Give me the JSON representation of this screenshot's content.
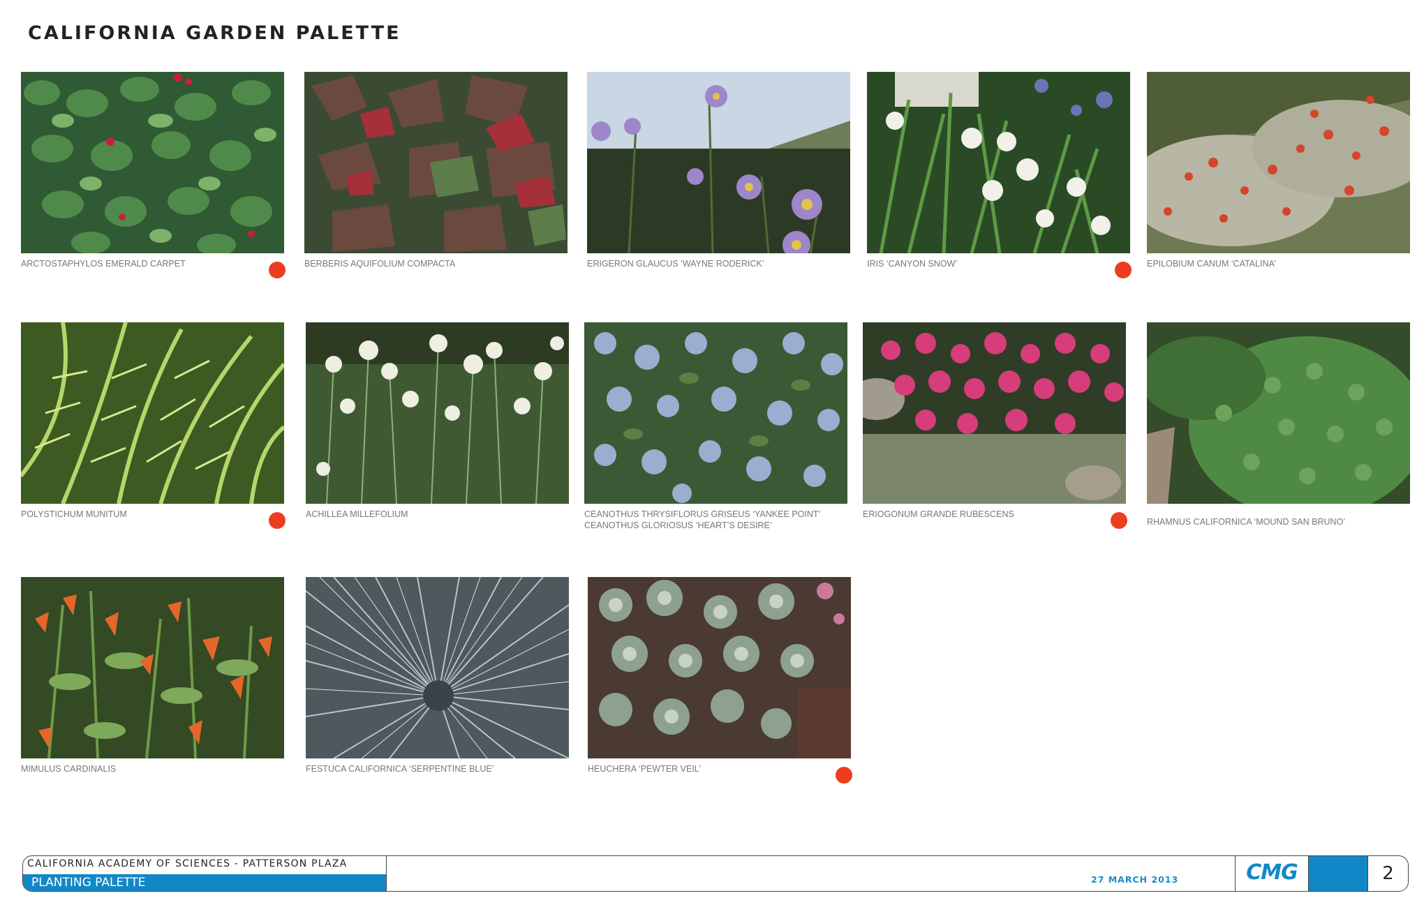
{
  "page": {
    "title": "CALIFORNIA GARDEN PALETTE",
    "marker_color": "#ec3d1f"
  },
  "plants": [
    {
      "caption": [
        "ARCTOSTAPHYLOS EMERALD CARPET"
      ],
      "marked": true
    },
    {
      "caption": [
        "BERBERIS AQUIFOLIUM COMPACTA"
      ],
      "marked": false
    },
    {
      "caption": [
        "ERIGERON GLAUCUS ‘WAYNE RODERICK’"
      ],
      "marked": false
    },
    {
      "caption": [
        "IRIS ‘CANYON SNOW’"
      ],
      "marked": true
    },
    {
      "caption": [
        "EPILOBIUM CANUM ‘CATALINA’"
      ],
      "marked": false
    },
    {
      "caption": [
        "POLYSTICHUM MUNITUM"
      ],
      "marked": true
    },
    {
      "caption": [
        "ACHILLEA MILLEFOLIUM"
      ],
      "marked": false
    },
    {
      "caption": [
        "CEANOTHUS THRYSIFLORUS GRISEUS ‘YANKEE POINT’",
        "CEANOTHUS GLORIOSUS ‘HEART’S DESIRE’"
      ],
      "marked": false
    },
    {
      "caption": [
        "ERIOGONUM GRANDE RUBESCENS"
      ],
      "marked": true
    },
    {
      "caption": [
        "RHAMNUS CALIFORNICA ‘MOUND SAN BRUNO’"
      ],
      "marked": false
    },
    {
      "caption": [
        "MIMULUS CARDINALIS"
      ],
      "marked": false
    },
    {
      "caption": [
        "FESTUCA CALIFORNICA ‘SERPENTINE BLUE’"
      ],
      "marked": false
    },
    {
      "caption": [
        "HEUCHERA  ‘PEWTER VEIL’"
      ],
      "marked": true
    }
  ],
  "title_block": {
    "client": "CALIFORNIA ACADEMY OF SCIENCES - PATTERSON PLAZA",
    "sheet_title": "PLANTING PALETTE",
    "date": "27 MARCH 2013",
    "logo": "CMG",
    "page_number": "2",
    "accent_color": "#1287c7"
  }
}
